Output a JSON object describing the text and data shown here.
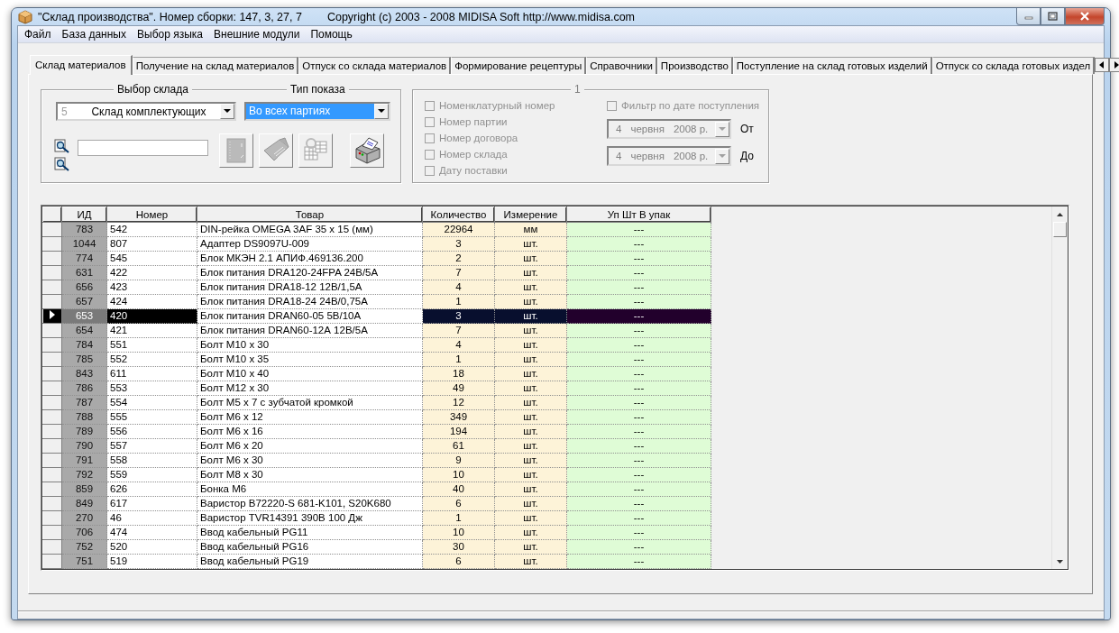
{
  "window": {
    "title": "\"Склад производства\". Номер сборки: 147, 3, 27, 7",
    "copyright": "Copyright (c) 2003 - 2008 MIDISA Soft http://www.midisa.com"
  },
  "menu": [
    "Файл",
    "База данных",
    "Выбор языка",
    "Внешние модули",
    "Помощь"
  ],
  "tabs": [
    {
      "label": "Склад материалов",
      "selected": true
    },
    {
      "label": "Получение на склад материалов",
      "selected": false
    },
    {
      "label": "Отпуск со склада материалов",
      "selected": false
    },
    {
      "label": "Формирование рецептуры",
      "selected": false
    },
    {
      "label": "Справочники",
      "selected": false
    },
    {
      "label": "Производство",
      "selected": false
    },
    {
      "label": "Поступление на склад готовых изделий",
      "selected": false
    },
    {
      "label": "Отпуск со склада готовых издел",
      "selected": false
    }
  ],
  "warehouse": {
    "title": "Выбор склада",
    "code": "5",
    "value": "Склад комплектующих"
  },
  "display_type": {
    "title": "Тип показа",
    "value": "Во всех партиях",
    "focused": true
  },
  "toolbar": [
    {
      "kind": "binder",
      "disabled": true
    },
    {
      "kind": "folder",
      "disabled": true
    },
    {
      "kind": "table",
      "disabled": true
    },
    {
      "kind": "printer",
      "disabled": false
    }
  ],
  "filter": {
    "title": "1",
    "options": [
      {
        "label": "Номенклатурный номер",
        "checked": false,
        "disabled": true
      },
      {
        "label": "Номер партии",
        "checked": false,
        "disabled": true
      },
      {
        "label": "Номер договора",
        "checked": false,
        "disabled": true
      },
      {
        "label": "Номер склада",
        "checked": false,
        "disabled": true
      },
      {
        "label": "Дату поставки",
        "checked": false,
        "disabled": true
      }
    ],
    "date_filter": {
      "label": "Фильтр по дате поступления",
      "checked": false,
      "disabled": true
    },
    "dates": [
      {
        "day": "4",
        "month": "червня",
        "year": "2008 р.",
        "label": "От",
        "disabled": true
      },
      {
        "day": "4",
        "month": "червня",
        "year": "2008 р.",
        "label": "До",
        "disabled": true
      }
    ]
  },
  "table": {
    "columns": [
      "ИД",
      "Номер",
      "Товар",
      "Количество",
      "Измерение",
      "Уп Шт В упак"
    ],
    "rows": [
      {
        "cells": [
          "783",
          "542",
          "DIN-рейка OMEGA 3AF 35 x 15 (мм)",
          "22964",
          "мм",
          "---"
        ],
        "selected": false
      },
      {
        "cells": [
          "1044",
          "807",
          "Адаптер DS9097U-009",
          "3",
          "шт.",
          "---"
        ],
        "selected": false
      },
      {
        "cells": [
          "774",
          "545",
          "Блок МКЭН 2.1 АПИФ.469136.200",
          "2",
          "шт.",
          "---"
        ],
        "selected": false
      },
      {
        "cells": [
          "631",
          "422",
          "Блок питания DRA120-24FPA 24В/5А",
          "7",
          "шт.",
          "---"
        ],
        "selected": false
      },
      {
        "cells": [
          "656",
          "423",
          "Блок питания DRA18-12 12В/1,5А",
          "4",
          "шт.",
          "---"
        ],
        "selected": false
      },
      {
        "cells": [
          "657",
          "424",
          "Блок питания DRA18-24 24В/0,75А",
          "1",
          "шт.",
          "---"
        ],
        "selected": false
      },
      {
        "cells": [
          "653",
          "420",
          "Блок питания DRAN60-05 5В/10А",
          "3",
          "шт.",
          "---"
        ],
        "selected": true
      },
      {
        "cells": [
          "654",
          "421",
          "Блок питания DRAN60-12А 12В/5А",
          "7",
          "шт.",
          "---"
        ],
        "selected": false
      },
      {
        "cells": [
          "784",
          "551",
          "Болт М10 x 30",
          "4",
          "шт.",
          "---"
        ],
        "selected": false
      },
      {
        "cells": [
          "785",
          "552",
          "Болт М10 x 35",
          "1",
          "шт.",
          "---"
        ],
        "selected": false
      },
      {
        "cells": [
          "843",
          "611",
          "Болт М10 x 40",
          "18",
          "шт.",
          "---"
        ],
        "selected": false
      },
      {
        "cells": [
          "786",
          "553",
          "Болт М12 x 30",
          "49",
          "шт.",
          "---"
        ],
        "selected": false
      },
      {
        "cells": [
          "787",
          "554",
          "Болт М5 x 7 с зубчатой кромкой",
          "12",
          "шт.",
          "---"
        ],
        "selected": false
      },
      {
        "cells": [
          "788",
          "555",
          "Болт М6 x 12",
          "349",
          "шт.",
          "---"
        ],
        "selected": false
      },
      {
        "cells": [
          "789",
          "556",
          "Болт М6 x 16",
          "194",
          "шт.",
          "---"
        ],
        "selected": false
      },
      {
        "cells": [
          "790",
          "557",
          "Болт М6 x 20",
          "61",
          "шт.",
          "---"
        ],
        "selected": false
      },
      {
        "cells": [
          "791",
          "558",
          "Болт М6 x 30",
          "9",
          "шт.",
          "---"
        ],
        "selected": false
      },
      {
        "cells": [
          "792",
          "559",
          "Болт М8 x 30",
          "10",
          "шт.",
          "---"
        ],
        "selected": false
      },
      {
        "cells": [
          "859",
          "626",
          "Бонка М6",
          "40",
          "шт.",
          "---"
        ],
        "selected": false
      },
      {
        "cells": [
          "849",
          "617",
          "Варистор B72220-S 681-K101, S20K680",
          "6",
          "шт.",
          "---"
        ],
        "selected": false
      },
      {
        "cells": [
          "270",
          "46",
          "Варистор TVR14391 390В 100 Дж",
          "1",
          "шт.",
          "---"
        ],
        "selected": false
      },
      {
        "cells": [
          "706",
          "474",
          "Ввод кабельный PG11",
          "10",
          "шт.",
          "---"
        ],
        "selected": false
      },
      {
        "cells": [
          "752",
          "520",
          "Ввод кабельный PG16",
          "30",
          "шт.",
          "---"
        ],
        "selected": false
      },
      {
        "cells": [
          "751",
          "519",
          "Ввод кабельный PG19",
          "6",
          "шт.",
          "---"
        ],
        "selected": false
      }
    ]
  }
}
